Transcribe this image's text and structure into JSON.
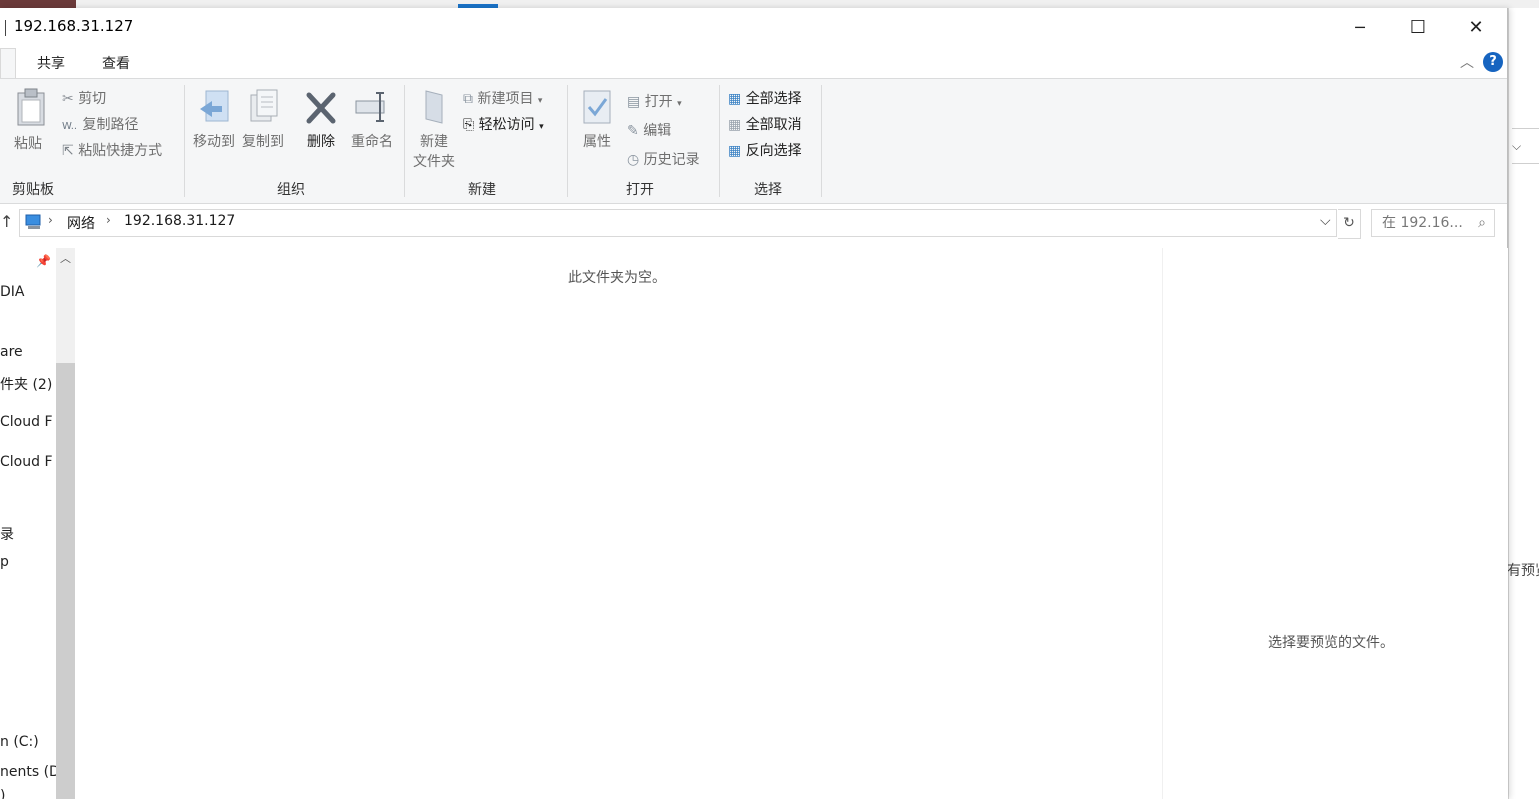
{
  "window": {
    "title": "192.168.31.127",
    "minimize_label": "─",
    "maximize_label": "☐",
    "close_label": "✕"
  },
  "tabs": [
    {
      "label": "共享"
    },
    {
      "label": "查看"
    }
  ],
  "ribbon": {
    "clipboard": {
      "group_label": "剪贴板",
      "paste": "粘贴",
      "cut": "剪切",
      "copy_path": "复制路径",
      "paste_shortcut": "粘贴快捷方式"
    },
    "organize": {
      "group_label": "组织",
      "move_to": "移动到",
      "copy_to": "复制到",
      "delete": "删除",
      "rename": "重命名"
    },
    "new": {
      "group_label": "新建",
      "new_folder_line1": "新建",
      "new_folder_line2": "文件夹",
      "new_item": "新建项目",
      "easy_access": "轻松访问"
    },
    "open": {
      "group_label": "打开",
      "properties": "属性",
      "open": "打开",
      "edit": "编辑",
      "history": "历史记录"
    },
    "select": {
      "group_label": "选择",
      "select_all": "全部选择",
      "select_none": "全部取消",
      "invert": "反向选择"
    }
  },
  "address": {
    "crumbs": [
      "网络",
      "192.168.31.127"
    ],
    "search_placeholder": "在 192.16..."
  },
  "nav": {
    "items": [
      "DIA",
      "are",
      "件夹 (2)",
      " Cloud F",
      " Cloud F",
      "录",
      "p",
      "n (C:)",
      "nents (D:",
      ")"
    ]
  },
  "content": {
    "empty_text": "此文件夹为空。",
    "preview_text": "选择要预览的文件。"
  },
  "background": {
    "right_text": "有预览"
  }
}
